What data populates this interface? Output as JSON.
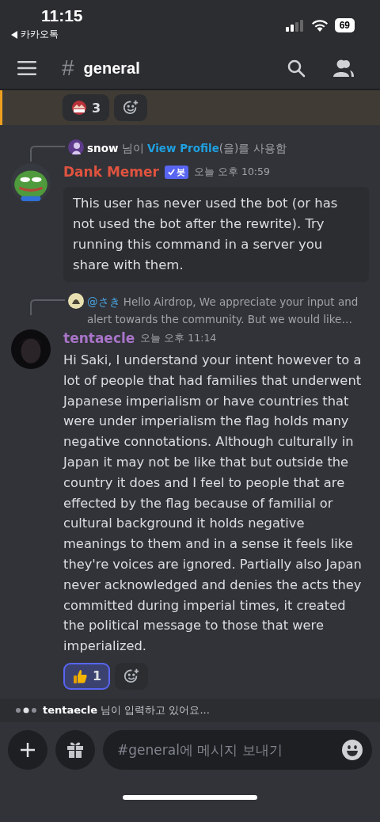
{
  "status_bar": {
    "time": "11:15",
    "back_app": "카카오톡",
    "battery": "69"
  },
  "header": {
    "hash": "#",
    "channel": "general"
  },
  "top_reactions": [
    {
      "kind": "server",
      "count": "3",
      "selected": false
    }
  ],
  "messages": [
    {
      "kind": "interaction",
      "reply": {
        "user": "snow",
        "before": " 님이 ",
        "command": "View Profile",
        "after": "(을)를 사용함"
      },
      "author": "Dank Memer",
      "color": "#e0533f",
      "badge": "봇",
      "time": "오늘 오후 10:59",
      "embed": "This user has never used the bot (or has not used the bot after the rewrite). Try running this command in a server you share with them."
    },
    {
      "kind": "reply",
      "reply": {
        "mention": "@さき",
        "text": "Hello Airdrop,  We appreciate your input and alert towards the community. But we would like…"
      },
      "author": "tentaecle",
      "color": "#a974c8",
      "time": "오늘 오후 11:14",
      "text": "Hi Saki, I understand your intent however to a lot of people that had families that underwent Japanese imperialism or have countries that were under imperialism the flag holds many negative connotations. Although culturally in Japan it may not be like that but outside the country it does and I feel to people that are effected by the flag because of familial or cultural background it holds negative meanings to them and in a sense it feels like they're voices are ignored. Partially also Japan never acknowledged and denies the acts they committed during imperial times, it created the political message to those that were imperialized.",
      "reactions": [
        {
          "kind": "thumbs",
          "count": "1",
          "selected": true
        }
      ]
    }
  ],
  "typing": {
    "user": "tentaecle",
    "text": " 님이 입력하고 있어요..."
  },
  "composer": {
    "placeholder": "#general에 메시지 보내기"
  }
}
